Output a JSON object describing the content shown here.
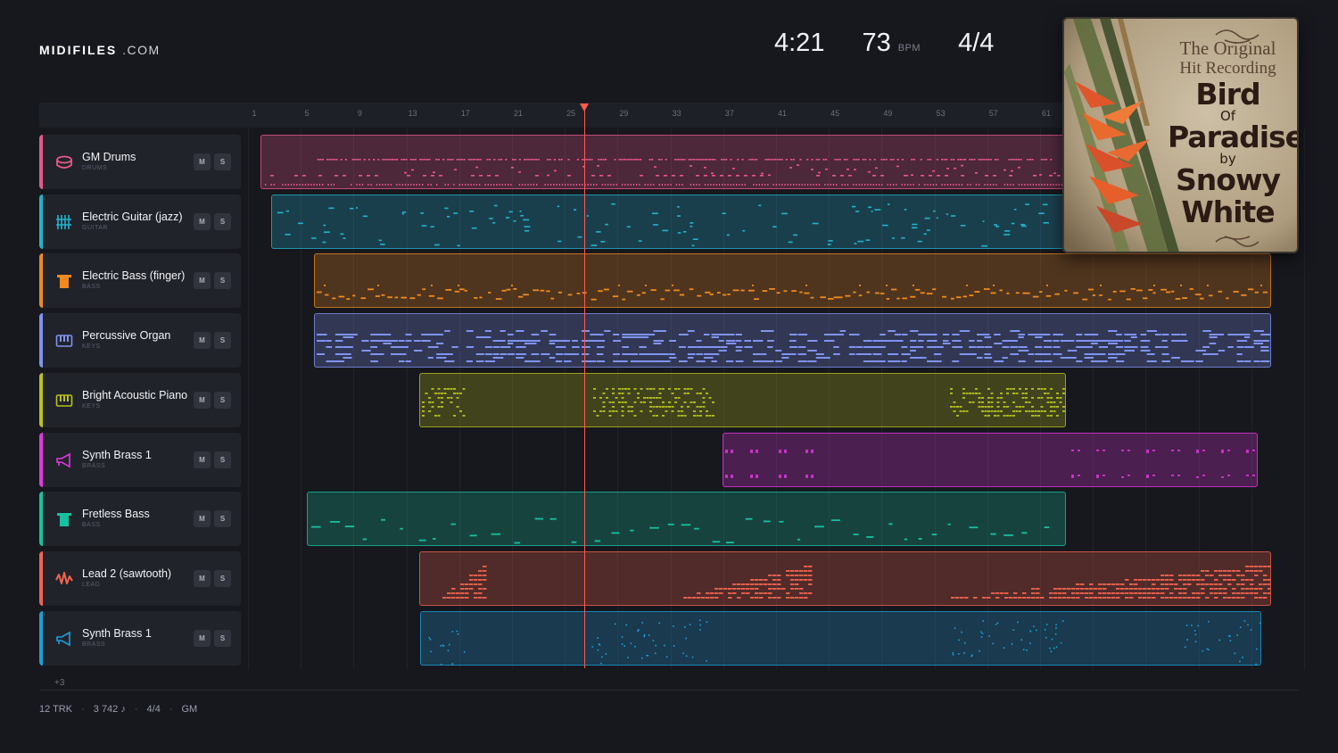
{
  "app": {
    "logo_bold": "MIDIFILES",
    "logo_light": ".COM"
  },
  "transport": {
    "time": "4:21",
    "tempo": "73",
    "tempo_unit": "BPM",
    "meter": "4/4"
  },
  "ruler": {
    "bars": [
      "1",
      "5",
      "9",
      "13",
      "17",
      "21",
      "25",
      "29",
      "33",
      "37",
      "41",
      "45",
      "49",
      "53",
      "57",
      "61"
    ],
    "playhead_bar": 26
  },
  "tracks": [
    {
      "name": "GM Drums",
      "category": "DRUMS",
      "color": "#e8588a",
      "icon": "drum-icon",
      "mute": "M",
      "solo": "S",
      "clip_start_bar": 1.5,
      "clip_end_bar": 78,
      "note_style": "drums"
    },
    {
      "name": "Electric Guitar (jazz)",
      "category": "GUITAR",
      "color": "#22b3cf",
      "icon": "guitar-icon",
      "mute": "M",
      "solo": "S",
      "clip_start_bar": 2.3,
      "clip_end_bar": 78,
      "note_style": "sparse"
    },
    {
      "name": "Electric Bass (finger)",
      "category": "BASS",
      "color": "#ef8a1f",
      "icon": "bass-icon",
      "mute": "M",
      "solo": "S",
      "clip_start_bar": 5.5,
      "clip_end_bar": 78,
      "note_style": "bass"
    },
    {
      "name": "Percussive Organ",
      "category": "KEYS",
      "color": "#7f93f0",
      "icon": "keys-icon",
      "mute": "M",
      "solo": "S",
      "clip_start_bar": 5.5,
      "clip_end_bar": 78,
      "note_style": "organ"
    },
    {
      "name": "Bright Acoustic Piano",
      "category": "KEYS",
      "color": "#b8c21c",
      "icon": "keys-icon",
      "mute": "M",
      "solo": "S",
      "clip_start_bar": 13.5,
      "clip_end_bar": 62.5,
      "note_style": "piano"
    },
    {
      "name": "Synth Brass 1",
      "category": "BRASS",
      "color": "#e238e0",
      "icon": "brass-icon",
      "mute": "M",
      "solo": "S",
      "clip_start_bar": 36.5,
      "clip_end_bar": 77,
      "note_style": "brass"
    },
    {
      "name": "Fretless Bass",
      "category": "BASS",
      "color": "#17c0a0",
      "icon": "bass-icon",
      "mute": "M",
      "solo": "S",
      "clip_start_bar": 5,
      "clip_end_bar": 62.5,
      "note_style": "fretless"
    },
    {
      "name": "Lead 2 (sawtooth)",
      "category": "LEAD",
      "color": "#f2644e",
      "icon": "lead-wave-icon",
      "mute": "M",
      "solo": "S",
      "clip_start_bar": 13.5,
      "clip_end_bar": 78,
      "note_style": "lead"
    },
    {
      "name": "Synth Brass 1",
      "category": "BRASS",
      "color": "#1e9fdc",
      "icon": "brass-icon",
      "mute": "M",
      "solo": "S",
      "clip_start_bar": 13.6,
      "clip_end_bar": 77.3,
      "note_style": "dots"
    }
  ],
  "more_tracks": "+3",
  "footer": {
    "tracks": "12 TRK",
    "notes": "3 742 ♪",
    "meter": "4/4",
    "standard": "GM"
  },
  "cover": {
    "line1": "The Original",
    "line2": "Hit Recording",
    "title1": "Bird",
    "title_of": "Of",
    "title2": "Paradise",
    "by": "by",
    "artist1": "Snowy",
    "artist2": "White"
  }
}
